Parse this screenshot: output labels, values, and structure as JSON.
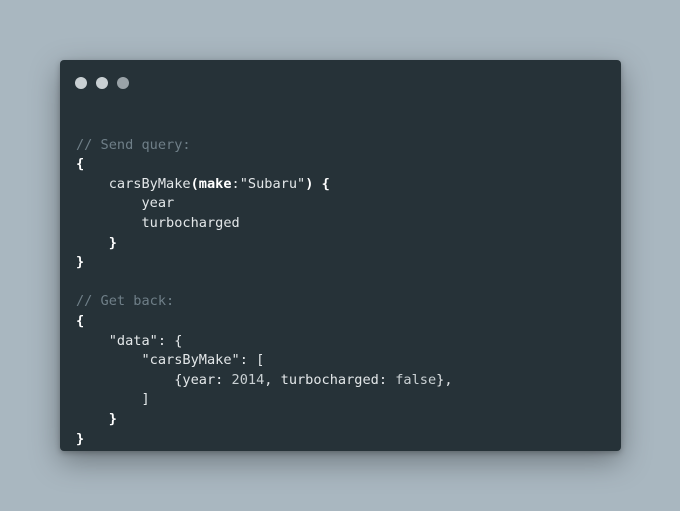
{
  "window": {
    "controls": [
      "close",
      "minimize",
      "maximize"
    ]
  },
  "code": {
    "comment_send": "// Send query:",
    "open_brace": "{",
    "query_fn": "carsByMake",
    "query_paren_open": "(",
    "query_arg_key": "make",
    "query_arg_sep": ":",
    "query_arg_value": "\"Subaru\"",
    "query_paren_close": ") {",
    "field_year": "year",
    "field_turbo": "turbocharged",
    "inner_close": "}",
    "outer_close": "}",
    "comment_get": "// Get back:",
    "resp_open": "{",
    "data_key": "\"data\"",
    "data_sep": ": {",
    "cbm_key": "\"carsByMake\"",
    "cbm_sep": ": [",
    "item_open": "{year: ",
    "item_year": "2014",
    "item_mid": ", turbocharged: ",
    "item_turbo": "false",
    "item_close": "},",
    "array_close": "]",
    "data_close": "}",
    "resp_close": "}"
  }
}
